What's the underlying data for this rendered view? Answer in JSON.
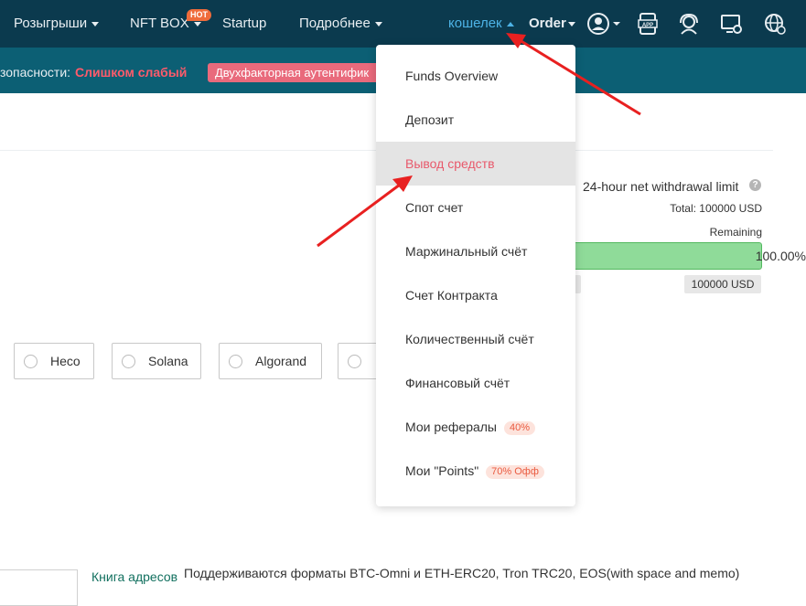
{
  "nav": {
    "items": [
      {
        "label": "Розыгрыши"
      },
      {
        "label": "NFT BOX",
        "badge": "HOT"
      },
      {
        "label": "Startup"
      },
      {
        "label": "Подробнее"
      },
      {
        "label": "кошелек"
      },
      {
        "label": "Order"
      }
    ],
    "icons": [
      "user-icon",
      "app-download-icon",
      "support-icon",
      "device-settings-icon",
      "globe-icon"
    ]
  },
  "security": {
    "label": "зопасности:",
    "value": "Слишком слабый",
    "twofa": "Двухфакторная аутентифик"
  },
  "limit": {
    "title": "24-hour net withdrawal limit",
    "help": "?",
    "total": "Total: 100000 USD",
    "remaining_label": "Remaining",
    "remaining_fraction": 1.0,
    "remaining_percent": "100.00%",
    "remaining_amount": "100000 USD"
  },
  "chains": [
    {
      "label": "Heco"
    },
    {
      "label": "Solana"
    },
    {
      "label": "Algorand"
    },
    {
      "label": ""
    }
  ],
  "address": {
    "book_link": "Книга адресов",
    "formats_note": "Поддерживаются форматы BTC-Omni и ETH-ERC20, Tron TRC20, EOS(with space and memo)"
  },
  "dropdown": {
    "items": [
      {
        "label": "Funds Overview"
      },
      {
        "label": "Депозит"
      },
      {
        "label": "Вывод средств",
        "active": true
      },
      {
        "label": "Спот счет"
      },
      {
        "label": "Маржинальный счёт"
      },
      {
        "label": "Счет Контракта"
      },
      {
        "label": "Количественный счёт"
      },
      {
        "label": "Финансовый счёт"
      },
      {
        "label": "Мои рефералы",
        "badge": "40%"
      },
      {
        "label": "Мои \"Points\"",
        "badge": "70% Офф"
      }
    ]
  },
  "colors": {
    "topbar": "#0b3a4e",
    "subbar": "#0c5f74",
    "accent_red": "#e8596b",
    "progress_green": "#8fdb99",
    "annotation_arrow": "#e82020"
  }
}
